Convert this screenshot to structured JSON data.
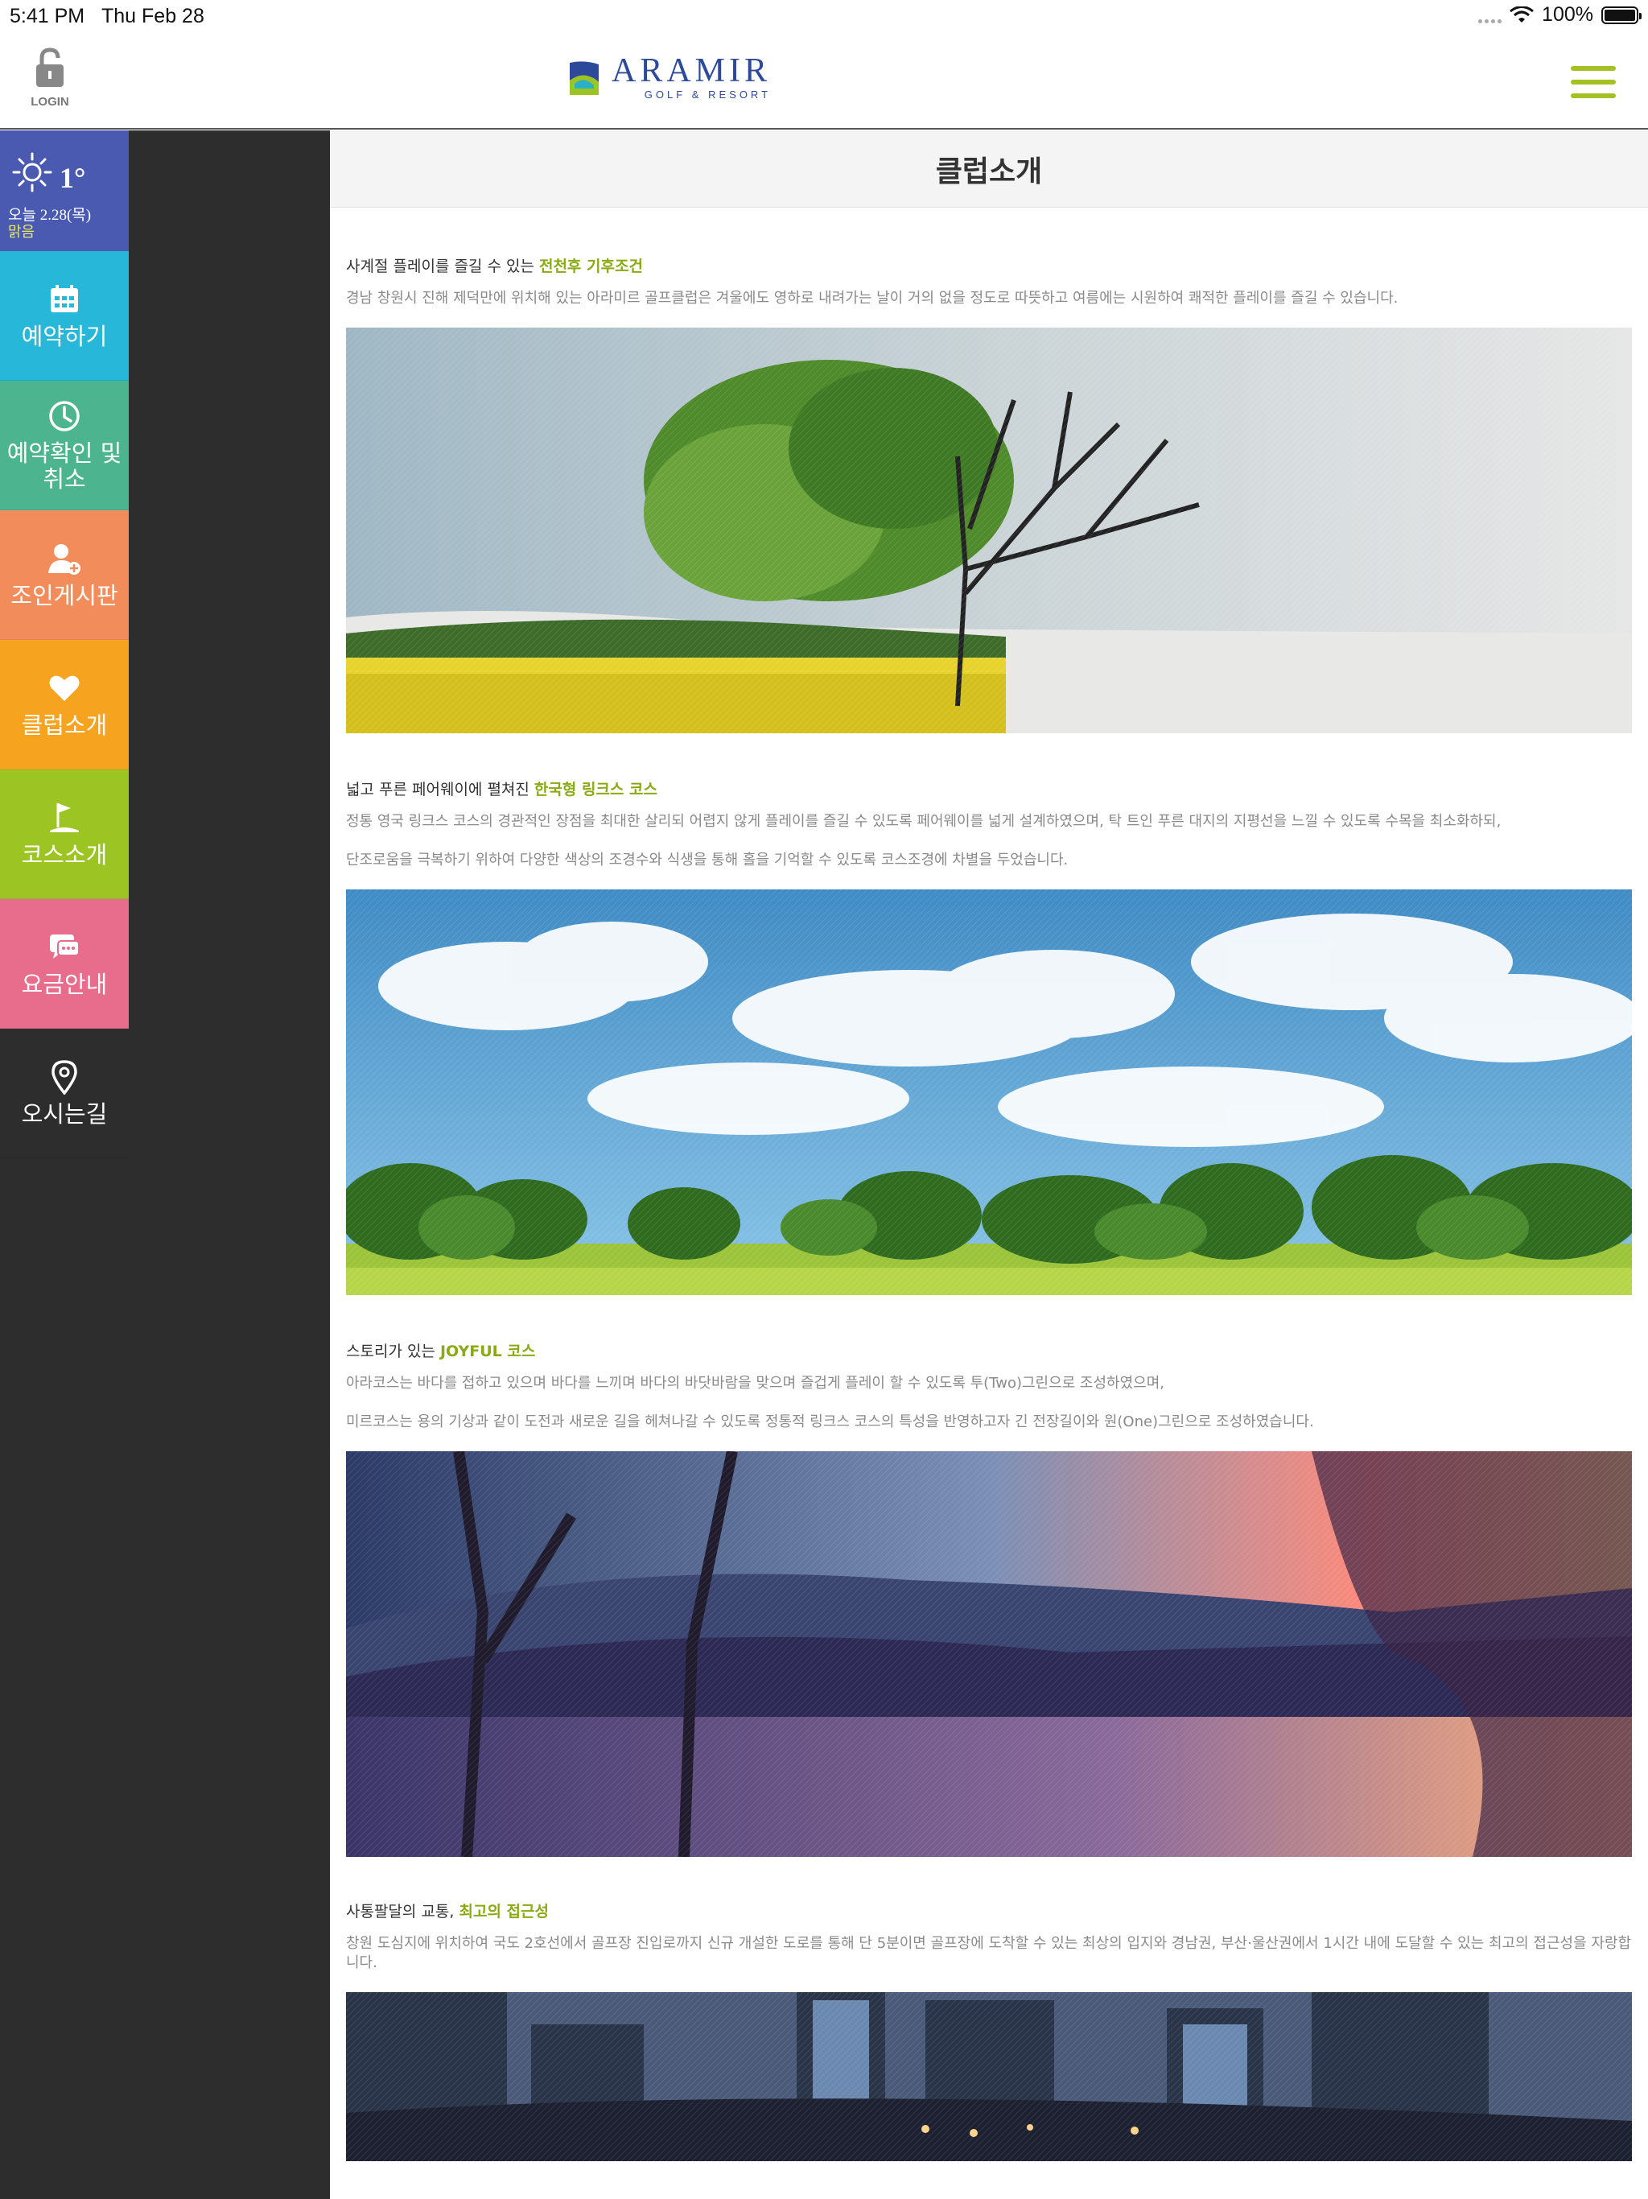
{
  "status_bar": {
    "time": "5:41 PM",
    "date": "Thu Feb 28",
    "battery": "100%"
  },
  "header": {
    "login_label": "LOGIN",
    "logo_name": "ARAMIR",
    "logo_sub": "GOLF & RESORT"
  },
  "sidebar": {
    "weather": {
      "temp": "1°",
      "date": "오늘 2.28(목)",
      "condition": "맑음",
      "icon": "sun-icon",
      "color": "#4a5ab0"
    },
    "items": [
      {
        "label": "예약하기",
        "icon": "calendar-icon",
        "color": "#27b7d9"
      },
      {
        "label": "예약확인 및 취소",
        "icon": "clock-icon",
        "color": "#4cb58f"
      },
      {
        "label": "조인게시판",
        "icon": "user-add-icon",
        "color": "#f28c5a"
      },
      {
        "label": "클럽소개",
        "icon": "heart-icon",
        "color": "#f6a41f"
      },
      {
        "label": "코스소개",
        "icon": "golf-flag-icon",
        "color": "#9cc524"
      },
      {
        "label": "요금안내",
        "icon": "chat-icon",
        "color": "#e86c8c"
      },
      {
        "label": "오시는길",
        "icon": "location-pin-icon",
        "color": "#2d2d2d"
      }
    ]
  },
  "main": {
    "page_title": "클럽소개",
    "sections": [
      {
        "heading_prefix": "사계절 플레이를 즐길 수 있는 ",
        "heading_highlight": "전천후 기후조건",
        "paragraphs": [
          "경남 창원시 진해 제덕만에 위치해 있는 아라미르 골프클럽은 겨울에도 영하로 내려가는 날이 거의 없을 정도로 따뜻하고 여름에는 시원하여 쾌적한 플레이를 즐길 수 있습니다."
        ],
        "image": "tree-seasons-image"
      },
      {
        "heading_prefix": "넓고 푸른 페어웨이에 펼쳐진 ",
        "heading_highlight": "한국형 링크스 코스",
        "paragraphs": [
          "정통 영국 링크스 코스의 경관적인 장점을 최대한 살리되 어렵지 않게 플레이를 즐길 수 있도록 페어웨이를 넓게 설계하였으며, 탁 트인 푸른 대지의 지평선을 느낄 수 있도록 수목을 최소화하되,",
          "단조로움을 극복하기 위하여 다양한 색상의 조경수와 식생을 통해 홀을 기억할 수 있도록 코스조경에 차별을 두었습니다."
        ],
        "image": "fairway-sky-image"
      },
      {
        "heading_prefix": "스토리가 있는 ",
        "heading_highlight": "JOYFUL 코스",
        "paragraphs": [
          "아라코스는 바다를 접하고 있으며 바다를 느끼며 바다의 바닷바람을 맞으며 즐겁게 플레이 할 수 있도록 투(Two)그린으로 조성하였으며,",
          "미르코스는 용의 기상과 같이 도전과 새로운 길을 헤쳐나갈 수 있도록 정통적 링크스 코스의 특성을 반영하고자 긴 전장길이와 원(One)그린으로 조성하였습니다."
        ],
        "image": "sunset-lake-image"
      },
      {
        "heading_prefix": "사통팔달의 교통, ",
        "heading_highlight": "최고의 접근성",
        "paragraphs": [
          "창원 도심지에 위치하여 국도 2호선에서 골프장 진입로까지 신규 개설한 도로를 통해 단 5분이면 골프장에 도착할 수 있는 최상의 입지와 경남권, 부산·울산권에서 1시간 내에 도달할 수 있는 최고의 접근성을 자랑합니다."
        ],
        "image": "city-night-image"
      }
    ]
  },
  "colors": {
    "accent": "#a4c123",
    "highlight": "#8aaa14",
    "logo": "#2d4a9a",
    "sidebar_bg": "#2d2d2d"
  }
}
